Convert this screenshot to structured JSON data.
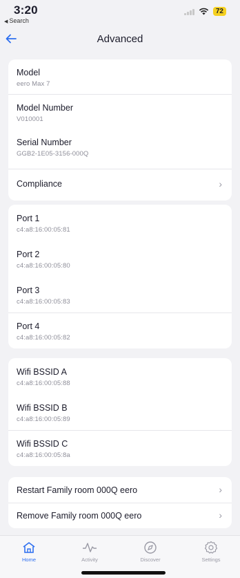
{
  "status": {
    "time": "3:20",
    "back_app": "Search",
    "battery": "72"
  },
  "header": {
    "title": "Advanced"
  },
  "device": {
    "model_label": "Model",
    "model_value": "eero Max 7",
    "model_number_label": "Model Number",
    "model_number_value": "V010001",
    "serial_label": "Serial Number",
    "serial_value": "GGB2-1E05-3156-000Q",
    "compliance_label": "Compliance"
  },
  "ports": [
    {
      "label": "Port 1",
      "value": "c4:a8:16:00:05:81"
    },
    {
      "label": "Port 2",
      "value": "c4:a8:16:00:05:80"
    },
    {
      "label": "Port 3",
      "value": "c4:a8:16:00:05:83"
    },
    {
      "label": "Port 4",
      "value": "c4:a8:16:00:05:82"
    }
  ],
  "bssids": [
    {
      "label": "Wifi BSSID A",
      "value": "c4:a8:16:00:05:88"
    },
    {
      "label": "Wifi BSSID B",
      "value": "c4:a8:16:00:05:89"
    },
    {
      "label": "Wifi BSSID C",
      "value": "c4:a8:16:00:05:8a"
    }
  ],
  "actions": {
    "restart": "Restart Family room 000Q eero",
    "remove": "Remove Family room 000Q eero"
  },
  "tabs": [
    {
      "label": "Home",
      "icon": "home-icon"
    },
    {
      "label": "Activity",
      "icon": "activity-icon"
    },
    {
      "label": "Discover",
      "icon": "discover-icon"
    },
    {
      "label": "Settings",
      "icon": "settings-icon"
    }
  ],
  "colors": {
    "accent": "#2d6ff0",
    "battery": "#f5d020"
  }
}
